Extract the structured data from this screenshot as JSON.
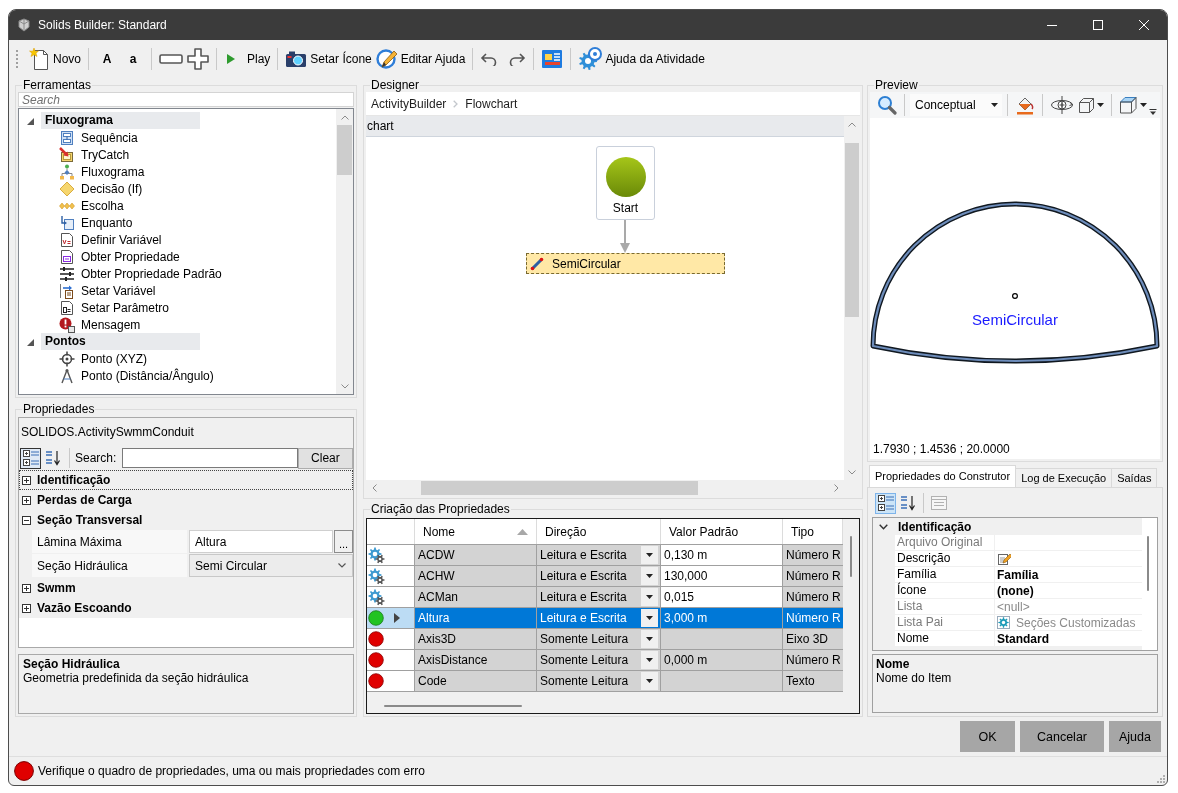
{
  "window": {
    "title": "Solids Builder: Standard"
  },
  "toolbar": {
    "new_label": "Novo",
    "letter_buttons": [
      "A",
      "a"
    ],
    "play_label": "Play",
    "set_icon_label": "Setar Ícone",
    "edit_help_label": "Editar Ajuda",
    "activity_help_label": "Ajuda da Atividade"
  },
  "tools": {
    "title": "Ferramentas",
    "search_placeholder": "Search",
    "groups": [
      {
        "label": "Fluxograma",
        "expanded": true,
        "children": [
          {
            "label": "Sequência"
          },
          {
            "label": "TryCatch"
          },
          {
            "label": "Fluxograma"
          },
          {
            "label": "Decisão (If)"
          },
          {
            "label": "Escolha"
          },
          {
            "label": "Enquanto"
          },
          {
            "label": "Definir Variável"
          },
          {
            "label": "Obter Propriedade"
          },
          {
            "label": "Obter Propriedade Padrão"
          },
          {
            "label": "Setar Variável"
          },
          {
            "label": "Setar Parâmetro"
          },
          {
            "label": "Mensagem"
          }
        ]
      },
      {
        "label": "Pontos",
        "expanded": true,
        "children": [
          {
            "label": "Ponto (XYZ)"
          },
          {
            "label": "Ponto (Distância/Ângulo)"
          }
        ]
      }
    ]
  },
  "properties": {
    "title": "Propriedades",
    "object_name": "SOLIDOS.ActivitySwmmConduit",
    "search_label": "Search:",
    "clear_button": "Clear",
    "categories": [
      {
        "label": "Identificação",
        "expanded": false,
        "focused": true
      },
      {
        "label": "Perdas de Carga",
        "expanded": false,
        "focused": false
      },
      {
        "label": "Seção Transversal",
        "expanded": true,
        "focused": false,
        "rows": [
          {
            "name": "Lâmina Máxima",
            "value": "Altura",
            "kind": "ellipsis",
            "button": "..."
          },
          {
            "name": "Seção Hidráulica",
            "value": "Semi Circular",
            "kind": "dropdown"
          }
        ]
      },
      {
        "label": "Swmm",
        "expanded": false,
        "focused": false
      },
      {
        "label": "Vazão Escoando",
        "expanded": false,
        "focused": false
      }
    ],
    "help": {
      "title": "Seção Hidráulica",
      "text": "Geometria predefinida da seção hidráulica"
    }
  },
  "designer": {
    "title": "Designer",
    "breadcrumb": [
      "ActivityBuilder",
      "Flowchart"
    ],
    "header": "chart",
    "start_label": "Start",
    "activity_label": "SemiCircular"
  },
  "property_grid": {
    "title": "Criação das Propriedades",
    "columns": [
      {
        "label": "Nome",
        "sorted": true
      },
      {
        "label": "Direção",
        "sorted": false
      },
      {
        "label": "Valor Padrão",
        "sorted": false
      },
      {
        "label": "Tipo",
        "sorted": false
      }
    ],
    "rows": [
      {
        "kind": "builtin",
        "name": "ACDW",
        "direction": "Leitura e Escrita",
        "value": "0,130 m",
        "type": "Número R",
        "editable": true,
        "selected": false
      },
      {
        "kind": "builtin",
        "name": "ACHW",
        "direction": "Leitura e Escrita",
        "value": "130,000",
        "type": "Número R",
        "editable": true,
        "selected": false
      },
      {
        "kind": "builtin",
        "name": "ACMan",
        "direction": "Leitura e Escrita",
        "value": "0,015",
        "type": "Número R",
        "editable": true,
        "selected": false
      },
      {
        "kind": "valid",
        "name": "Altura",
        "direction": "Leitura e Escrita",
        "value": "3,000 m",
        "type": "Número R",
        "editable": true,
        "selected": true
      },
      {
        "kind": "error",
        "name": "Axis3D",
        "direction": "Somente Leitura",
        "type": "Eixo 3D",
        "editable": false,
        "selected": false
      },
      {
        "kind": "error",
        "name": "AxisDistance",
        "direction": "Somente Leitura",
        "value": "0,000 m",
        "type": "Número R",
        "editable": false,
        "selected": false
      },
      {
        "kind": "error",
        "name": "Code",
        "direction": "Somente Leitura",
        "type": "Texto",
        "editable": false,
        "selected": false
      }
    ]
  },
  "preview": {
    "title": "Preview",
    "visual_style": "Conceptual",
    "shape_label": "SemiCircular",
    "coordinates": "1.7930 ; 1.4536 ; 20.0000"
  },
  "builder_tabs": [
    {
      "label": "Propriedades do Construtor",
      "selected": true
    },
    {
      "label": "Log de Execução",
      "selected": false
    },
    {
      "label": "Saídas",
      "selected": false
    }
  ],
  "builder_properties": {
    "category": "Identificação",
    "expanded": true,
    "rows": [
      {
        "name": "Arquivo Original",
        "kind": "empty",
        "disabled": true,
        "modified": false
      },
      {
        "name": "Descrição",
        "kind": "icon",
        "disabled": false,
        "modified": false
      },
      {
        "name": "Família",
        "value": "Família",
        "kind": "text",
        "disabled": false,
        "modified": true
      },
      {
        "name": "Ícone",
        "value": "(none)",
        "kind": "text",
        "disabled": false,
        "modified": true
      },
      {
        "name": "Lista",
        "value": "<null>",
        "kind": "text",
        "disabled": true,
        "modified": false
      },
      {
        "name": "Lista Pai",
        "value": "Seções Customizadas",
        "kind": "icon_text",
        "disabled": true,
        "modified": false
      },
      {
        "name": "Nome",
        "value": "Standard",
        "kind": "text",
        "disabled": false,
        "modified": true
      }
    ],
    "help": {
      "title": "Nome",
      "text": "Nome do Item"
    }
  },
  "buttons": [
    "OK",
    "Cancelar",
    "Ajuda"
  ],
  "status_bar": {
    "kind": "error",
    "message": "Verifique o quadro de propriedades, uma ou mais propriedades com erro"
  }
}
